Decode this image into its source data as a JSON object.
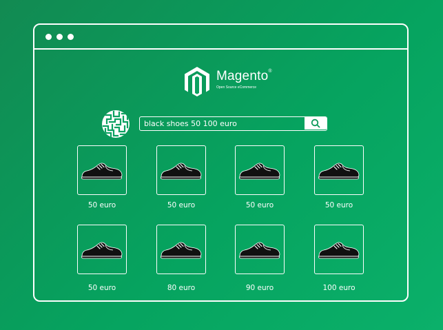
{
  "browser": {
    "window_dots": 3
  },
  "logo": {
    "word": "Magento",
    "trademark": "®",
    "tagline": "Open Source eCommerce"
  },
  "search": {
    "query": "black shoes 50 100 euro",
    "button_icon": "search-icon"
  },
  "avatar": {
    "icon": "maze-pattern-icon"
  },
  "products": [
    {
      "icon": "sneaker-icon",
      "price": "50 euro"
    },
    {
      "icon": "sneaker-icon",
      "price": "50 euro"
    },
    {
      "icon": "sneaker-icon",
      "price": "50 euro"
    },
    {
      "icon": "sneaker-icon",
      "price": "50 euro"
    },
    {
      "icon": "sneaker-icon",
      "price": "50 euro"
    },
    {
      "icon": "sneaker-icon",
      "price": "80 euro"
    },
    {
      "icon": "sneaker-icon",
      "price": "90 euro"
    },
    {
      "icon": "sneaker-icon",
      "price": "100 euro"
    }
  ],
  "colors": {
    "background": "#06a35f",
    "foreground": "#ffffff",
    "shoe": "#111111",
    "search_button_icon": "#0a9a5a"
  }
}
